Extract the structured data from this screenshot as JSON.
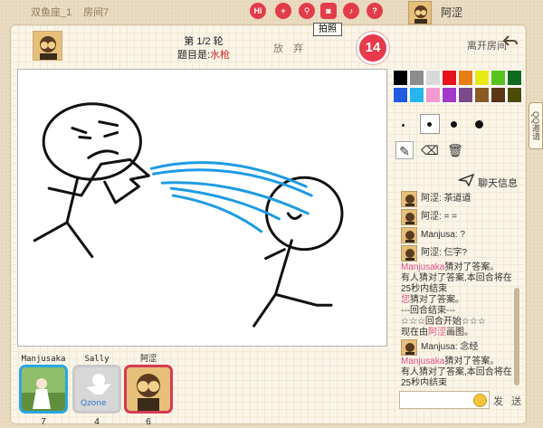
{
  "top_bar": {
    "room_name": "双鱼座_1",
    "room_id": "房间7",
    "icons": [
      {
        "name": "hi-icon",
        "label": "Hi"
      },
      {
        "name": "add-friend-icon",
        "label": "+"
      },
      {
        "name": "search-icon",
        "label": "⚲"
      },
      {
        "name": "camera-icon",
        "label": "◙"
      },
      {
        "name": "sound-icon",
        "label": "♪"
      },
      {
        "name": "help-icon",
        "label": "?"
      }
    ],
    "tooltip": "拍照",
    "username": "阿涩"
  },
  "game": {
    "round_text": "第 1/2 轮",
    "hint_prefix": "题目是:",
    "hint_word": "水枪",
    "give_up": "放 弃",
    "timer": "14",
    "leave_room": "离开房间"
  },
  "palette": {
    "colors": [
      "#000000",
      "#8c8c8c",
      "#d9d9d9",
      "#e8131d",
      "#e87d14",
      "#e9e916",
      "#54c41b",
      "#0d6b1e",
      "#1f5ce0",
      "#27b6ec",
      "#f29ad0",
      "#a239c9",
      "#7a4a8a",
      "#8a5b23",
      "#5a3616",
      "#4c4c08"
    ]
  },
  "tools": {
    "pen": "✎",
    "eraser": "⌫",
    "trash": "🗑"
  },
  "chat": {
    "title": "聊天信息",
    "messages": [
      {
        "type": "user",
        "name": "阿涩",
        "text": "茶道道"
      },
      {
        "type": "user",
        "name": "阿涩",
        "text": "= ="
      },
      {
        "type": "user",
        "name": "Manjusa",
        "text": "?"
      },
      {
        "type": "user",
        "name": "阿涩",
        "text": "仨字?"
      },
      {
        "type": "sys",
        "parts": [
          {
            "t": "Manjusaka",
            "pink": true
          },
          {
            "t": "猜对了答案。",
            "pink": false
          }
        ]
      },
      {
        "type": "sys",
        "parts": [
          {
            "t": "有人猜对了答案,本回合将在25秒内结束",
            "pink": false
          }
        ]
      },
      {
        "type": "sys",
        "parts": [
          {
            "t": "您",
            "pink": true
          },
          {
            "t": "猜对了答案。",
            "pink": false
          }
        ]
      },
      {
        "type": "sys",
        "parts": [
          {
            "t": "---回合结束---",
            "pink": false
          }
        ]
      },
      {
        "type": "sys",
        "parts": [
          {
            "t": "☆☆☆回合开始☆☆☆",
            "pink": false
          }
        ]
      },
      {
        "type": "sys",
        "parts": [
          {
            "t": "现在由",
            "pink": false
          },
          {
            "t": "阿涩",
            "pink": true
          },
          {
            "t": "画图。",
            "pink": false
          }
        ]
      },
      {
        "type": "user",
        "name": "Manjusa",
        "text": "念经"
      },
      {
        "type": "sys",
        "parts": [
          {
            "t": "Manjusaka",
            "pink": true
          },
          {
            "t": "猜对了答案。",
            "pink": false
          }
        ]
      },
      {
        "type": "sys",
        "parts": [
          {
            "t": "有人猜对了答案,本回合将在25秒内结束",
            "pink": false
          }
        ]
      }
    ],
    "send_label": "发 送",
    "input_value": ""
  },
  "side_tab": "QQ邀请",
  "players": [
    {
      "name": "Manjusaka",
      "score": "7",
      "border": "#2aa6e3"
    },
    {
      "name": "Sally",
      "score": "4",
      "border": "#c9c9c9"
    },
    {
      "name": "阿涩",
      "score": "6",
      "border": "#d63a54"
    }
  ]
}
